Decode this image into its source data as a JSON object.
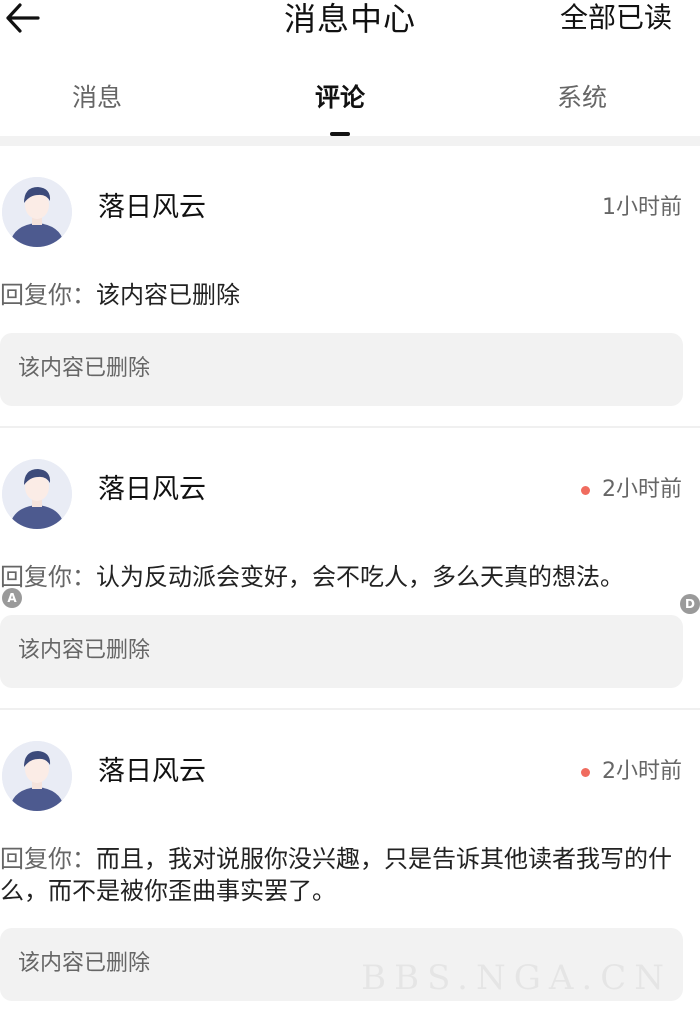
{
  "header": {
    "title": "消息中心",
    "mark_all_read": "全部已读",
    "back_icon": "arrow-left-icon"
  },
  "tabs": [
    {
      "label": "消息",
      "active": false
    },
    {
      "label": "评论",
      "active": true
    },
    {
      "label": "系统",
      "active": false
    }
  ],
  "comments": [
    {
      "user": "落日风云",
      "time": "1小时前",
      "unread": false,
      "reply_prefix": "回复你：",
      "reply_text": "该内容已删除",
      "quoted": "该内容已删除"
    },
    {
      "user": "落日风云",
      "time": "2小时前",
      "unread": true,
      "reply_prefix": "回复你：",
      "reply_text": "认为反动派会变好，会不吃人，多么天真的想法。",
      "quoted": "该内容已删除"
    },
    {
      "user": "落日风云",
      "time": "2小时前",
      "unread": true,
      "reply_prefix": "回复你：",
      "reply_text": "而且，我对说服你没兴趣，只是告诉其他读者我写的什么，而不是被你歪曲事实罢了。",
      "quoted": "该内容已删除"
    }
  ],
  "overlay_markers": {
    "a": "A",
    "d": "D"
  },
  "watermark": "BBS.NGA.CN",
  "colors": {
    "unread_dot": "#f06c5f",
    "quote_bg": "#f2f2f2",
    "active_tab": "#111111"
  }
}
